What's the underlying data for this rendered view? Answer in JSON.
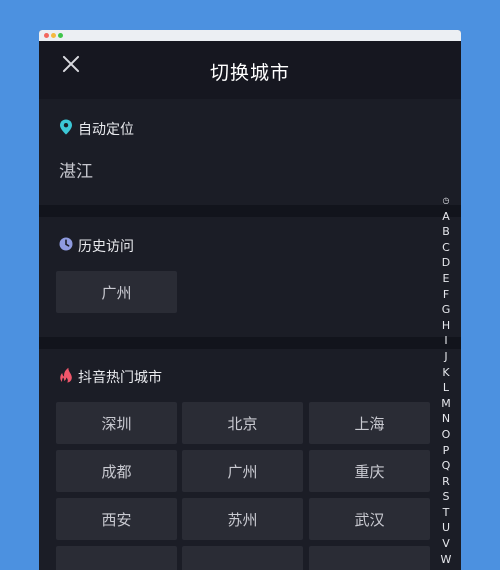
{
  "header": {
    "title": "切换城市"
  },
  "location": {
    "label": "自动定位",
    "city": "湛江"
  },
  "history": {
    "label": "历史访问",
    "cities": [
      "广州"
    ]
  },
  "hot": {
    "label": "抖音热门城市",
    "cities": [
      "深圳",
      "北京",
      "上海",
      "成都",
      "广州",
      "重庆",
      "西安",
      "苏州",
      "武汉"
    ]
  },
  "index_letters": [
    "◷",
    "A",
    "B",
    "C",
    "D",
    "E",
    "F",
    "G",
    "H",
    "I",
    "J",
    "K",
    "L",
    "M",
    "N",
    "O",
    "P",
    "Q",
    "R",
    "S",
    "T",
    "U",
    "V",
    "W"
  ],
  "colors": {
    "page_bg": "#4c91e0",
    "app_bg": "#12141c",
    "section_bg": "#1b1d26",
    "chip_bg": "#2a2c35",
    "pin_icon": "#3cc7d6",
    "clock_icon": "#8f9be0",
    "flame_icon": "#f0566a"
  }
}
